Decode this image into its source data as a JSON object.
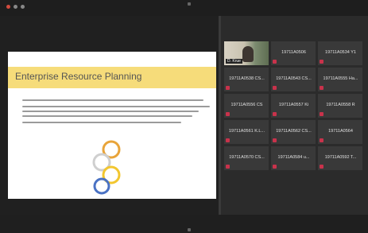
{
  "slide": {
    "title": "Enterprise Resource Planning",
    "band_color": "#f6dc7a"
  },
  "participants": [
    {
      "name": "",
      "video": true,
      "self_label": "D. Krue"
    },
    {
      "name": "19711A0506"
    },
    {
      "name": "19711A0534 Y1"
    },
    {
      "name": "19711A0538 CS..."
    },
    {
      "name": "19711A0543 CS..."
    },
    {
      "name": "19711A0555 Ha..."
    },
    {
      "name": "19711A0556 CS"
    },
    {
      "name": "19711A0557 Ki"
    },
    {
      "name": "19711A0558 R"
    },
    {
      "name": "19711A0561 K.L..."
    },
    {
      "name": "19711A0562 CS..."
    },
    {
      "name": "19711A0564"
    },
    {
      "name": "19711A0570 CS..."
    },
    {
      "name": "19711A0584 u..."
    },
    {
      "name": "19711A0592 T..."
    }
  ],
  "colors": {
    "mic_muted": "#c8324b",
    "tile_bg": "#393939"
  }
}
